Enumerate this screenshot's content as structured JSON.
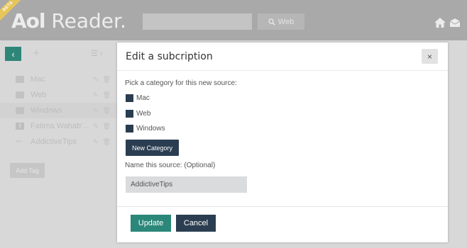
{
  "header": {
    "beta_label": "BETA",
    "logo_brand": "Aol",
    "logo_product": "Reader.",
    "search_placeholder": "",
    "search_button_label": "Web"
  },
  "sidebar": {
    "tags": [
      {
        "label": "Mac",
        "icon": "folder-icon",
        "selected": false
      },
      {
        "label": "Web",
        "icon": "folder-icon",
        "selected": false
      },
      {
        "label": "Windows",
        "icon": "folder-icon",
        "selected": true
      },
      {
        "label": "Fatima Wahab'...",
        "icon": "facebook-icon",
        "selected": false
      },
      {
        "label": "AddictiveTips",
        "icon": "dots-icon",
        "selected": false
      }
    ],
    "add_tag_label": "Add Tag"
  },
  "modal": {
    "title": "Edit a subcription",
    "close_label": "×",
    "pick_label": "Pick a category for this new source:",
    "categories": [
      "Mac",
      "Web",
      "Windows"
    ],
    "new_category_label": "New Category",
    "name_label": "Name this source: (Optional)",
    "name_value": "AddictiveTips",
    "update_label": "Update",
    "cancel_label": "Cancel"
  },
  "colors": {
    "accent_green": "#2b8779",
    "navy": "#2b3e51",
    "overlay_gray": "#d8d8d8"
  }
}
